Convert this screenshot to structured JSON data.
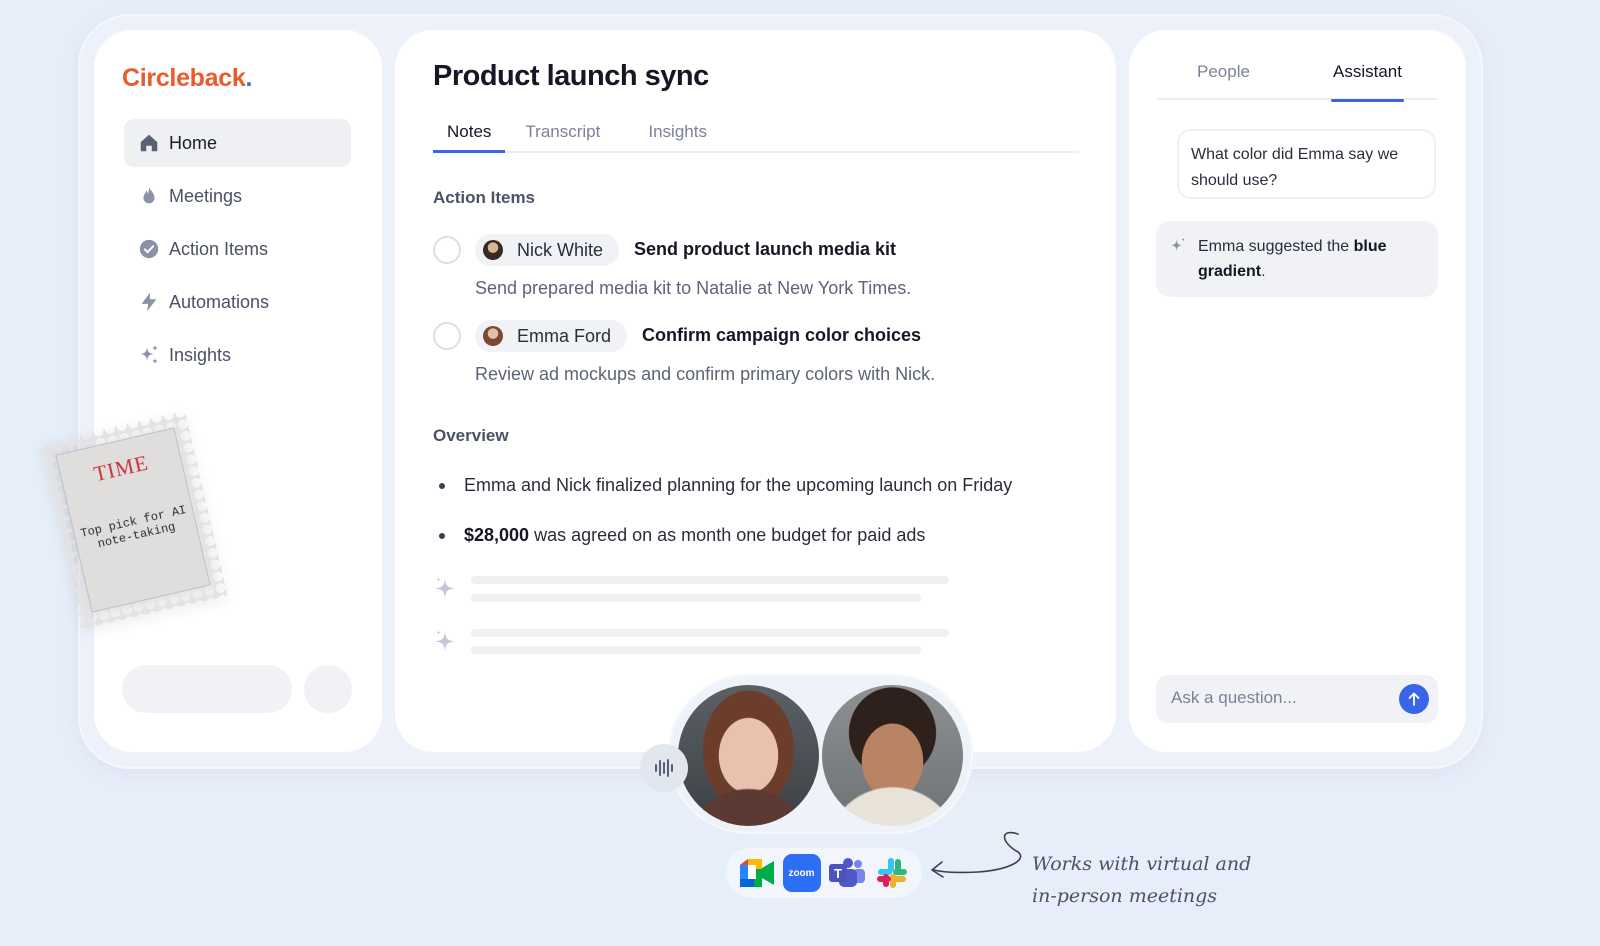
{
  "brand": {
    "name": "Circleback",
    "dot": "."
  },
  "sidebar": {
    "items": [
      {
        "label": "Home",
        "icon": "home-icon",
        "active": true
      },
      {
        "label": "Meetings",
        "icon": "flame-icon"
      },
      {
        "label": "Action Items",
        "icon": "check-circle-icon"
      },
      {
        "label": "Automations",
        "icon": "lightning-icon"
      },
      {
        "label": "Insights",
        "icon": "sparkles-icon"
      }
    ]
  },
  "stamp": {
    "title": "TIME",
    "line1": "Top pick for AI",
    "line2": "note-taking"
  },
  "main": {
    "title": "Product launch sync",
    "tabs": [
      {
        "label": "Notes",
        "active": true
      },
      {
        "label": "Transcript"
      },
      {
        "label": "Insights"
      }
    ],
    "action_items_heading": "Action Items",
    "action_items": [
      {
        "person": "Nick White",
        "task": "Send product launch media kit",
        "desc": "Send prepared media kit to Natalie at New York Times."
      },
      {
        "person": "Emma Ford",
        "task": "Confirm campaign color choices",
        "desc": "Review ad mockups and confirm primary colors with Nick."
      }
    ],
    "overview_heading": "Overview",
    "overview": [
      {
        "bold": "",
        "text": "Emma and Nick finalized  planning for the upcoming launch on Friday"
      },
      {
        "bold": "$28,000",
        "text": "was agreed on as month one budget for paid ads"
      }
    ]
  },
  "assistant": {
    "tabs": {
      "people": "People",
      "assistant": "Assistant"
    },
    "question": "What color did Emma say we should use?",
    "answer_prefix": "Emma suggested the ",
    "answer_bold": "blue gradient",
    "answer_suffix": ".",
    "ask_placeholder": "Ask a question..."
  },
  "integrations": {
    "apps": [
      "google-meet-icon",
      "zoom-icon",
      "teams-icon",
      "slack-icon"
    ],
    "zoom_label": "zoom",
    "teams_label": "T",
    "note_line1": "Works with virtual and",
    "note_line2": "in-person meetings"
  },
  "colors": {
    "brand": "#ec5a2c",
    "accent": "#3a65e8",
    "background": "#e6eef9"
  }
}
